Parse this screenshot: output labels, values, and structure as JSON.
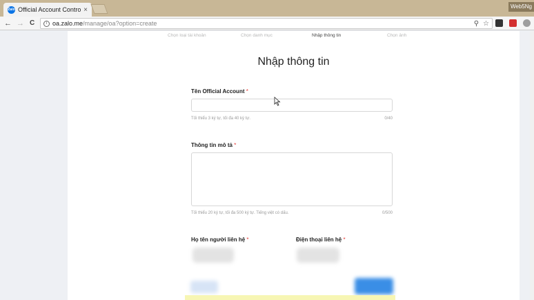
{
  "browser": {
    "tab_title": "Official Account Control",
    "tab_close": "×",
    "favicon_text": "Zalo",
    "profile_label": "Web5Ng",
    "url_host": "oa.zalo.me",
    "url_path": "/manage/oa?option=create",
    "nav_back": "←",
    "nav_forward": "→",
    "nav_reload": "C",
    "search_icon": "⚲",
    "star_icon": "☆"
  },
  "steps": [
    "Chọn loại tài khoản",
    "Chọn danh mục",
    "Nhập thông tin",
    "Chọn ảnh"
  ],
  "active_step": 2,
  "form": {
    "heading": "Nhập thông tin",
    "name": {
      "label": "Tên Official Account",
      "required": "*",
      "value": "",
      "hint": "Tối thiểu 3 ký tự, tối đa 40 ký tự.",
      "counter": "0/40"
    },
    "description": {
      "label": "Thông tin mô tả",
      "required": "*",
      "value": "",
      "hint": "Tối thiểu 20 ký tự, tối đa 500 ký tự. Tiếng việt có dấu.",
      "counter": "0/500"
    },
    "contact_name": {
      "label": "Họ tên người liên hệ",
      "required": "*"
    },
    "contact_phone": {
      "label": "Điện thoại liên hệ",
      "required": "*"
    }
  },
  "colors": {
    "accent": "#0b74e5",
    "required": "#e53935",
    "primary_button": "#3a8ee6"
  }
}
